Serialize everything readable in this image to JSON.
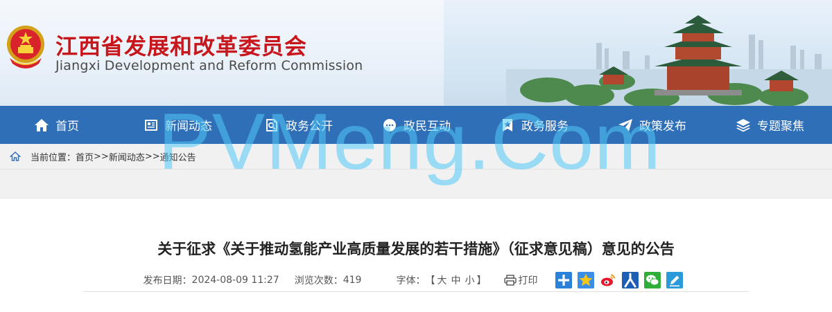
{
  "header": {
    "title_cn": "江西省发展和改革委员会",
    "title_en": "Jiangxi Development and Reform Commission",
    "emblem_icon": "national-emblem-icon",
    "brand_color": "#c8161d"
  },
  "nav": {
    "background": "#2f6fb8",
    "items": [
      {
        "label": "首页",
        "icon": "home-icon"
      },
      {
        "label": "新闻动态",
        "icon": "news-icon"
      },
      {
        "label": "政务公开",
        "icon": "search-doc-icon"
      },
      {
        "label": "政民互动",
        "icon": "chat-icon"
      },
      {
        "label": "政务服务",
        "icon": "bookmark-star-icon"
      },
      {
        "label": "政策发布",
        "icon": "paper-plane-icon"
      },
      {
        "label": "专题聚焦",
        "icon": "layers-icon"
      }
    ]
  },
  "breadcrumb": {
    "prefix": "当前位置：",
    "items": [
      "首页",
      "新闻动态",
      "通知公告"
    ],
    "separator": ">>"
  },
  "article": {
    "title": "关于征求《关于推动氢能产业高质量发展的若干措施》（征求意见稿）意见的公告",
    "date_label": "发布日期：",
    "date": "2024-08-09 11:27",
    "views_label": "浏览次数：",
    "views": "419",
    "font_label": "字体：",
    "font_open": "【",
    "font_large": "大",
    "font_medium": "中",
    "font_small": "小",
    "font_close": "】",
    "print_label": "打印"
  },
  "share": {
    "icons": [
      "share-plus-icon",
      "qzone-star-icon",
      "weibo-icon",
      "renren-icon",
      "wechat-icon",
      "edit-icon"
    ]
  },
  "watermark": "PVMeng.Com"
}
